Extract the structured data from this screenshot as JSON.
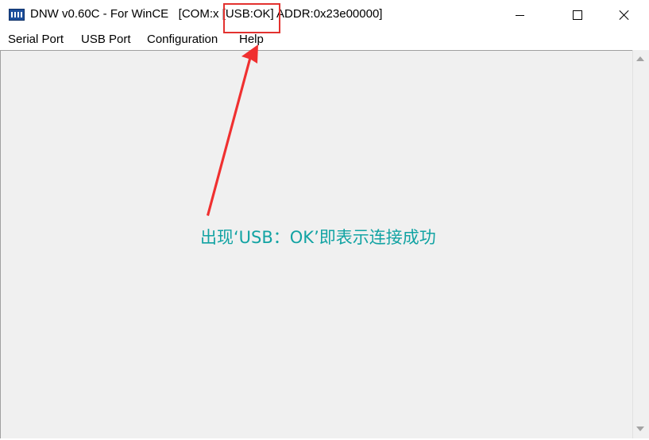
{
  "window": {
    "title": "DNW v0.60C - For WinCE   [COM:x [USB:OK] ADDR:0x23e00000]"
  },
  "menu": {
    "items": [
      {
        "label": "Serial Port"
      },
      {
        "label": "USB Port"
      },
      {
        "label": "Configuration"
      },
      {
        "label": "Help"
      }
    ]
  },
  "annotation": {
    "text": "出现‘USB：OK’即表示连接成功",
    "color": "#12a3a3",
    "highlight_color": "#e3322f"
  },
  "icons": {
    "app": "dnw-app-icon",
    "minimize": "minimize-icon",
    "maximize": "maximize-icon",
    "close": "close-icon"
  }
}
